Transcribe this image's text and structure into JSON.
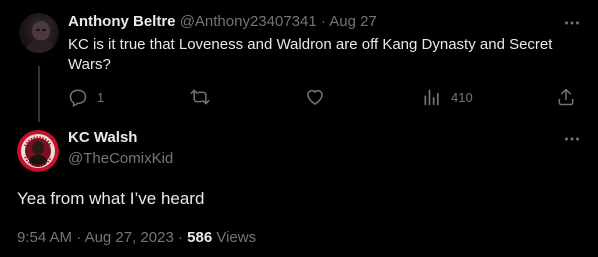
{
  "colors": {
    "background": "#000000",
    "primary_text": "#e7e9ea",
    "secondary_text": "#71767b",
    "thread_line": "#333639",
    "badge_red": "#c8102e"
  },
  "parent_tweet": {
    "display_name": "Anthony Beltre",
    "handle": "@Anthony23407341",
    "separator": "·",
    "date": "Aug 27",
    "text": "KC is it true that Loveness and Waldron are off Kang Dynasty and Secret Wars?",
    "more_icon": "more-horizontal-icon",
    "actions": {
      "reply": {
        "icon": "reply-icon",
        "count": "1"
      },
      "retweet": {
        "icon": "retweet-icon",
        "count": ""
      },
      "like": {
        "icon": "heart-icon",
        "count": ""
      },
      "views": {
        "icon": "analytics-icon",
        "count": "410"
      },
      "share": {
        "icon": "share-icon"
      }
    }
  },
  "main_tweet": {
    "display_name": "KC Walsh",
    "handle": "@TheComixKid",
    "text": "Yea from what I’ve heard",
    "more_icon": "more-horizontal-icon",
    "time": "9:54 AM",
    "separator": "·",
    "date": "Aug 27, 2023",
    "views_count": "586",
    "views_label": "Views"
  }
}
